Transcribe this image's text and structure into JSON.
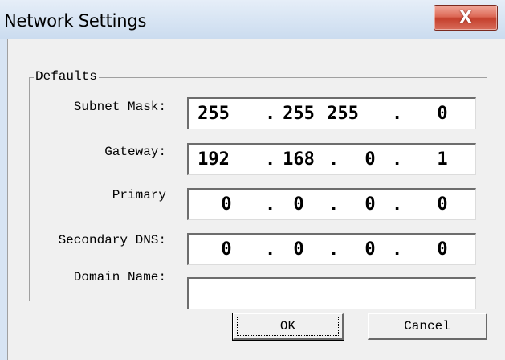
{
  "window": {
    "title": "Network Settings",
    "close_glyph": "X"
  },
  "group": {
    "legend": "Defaults"
  },
  "fields": {
    "subnet_mask": {
      "label": "Subnet Mask:",
      "octets": [
        "255",
        "255",
        "255",
        "0"
      ]
    },
    "gateway": {
      "label": "Gateway:",
      "octets": [
        "192",
        "168",
        "0",
        "1"
      ]
    },
    "primary": {
      "label": "Primary",
      "octets": [
        "0",
        "0",
        "0",
        "0"
      ]
    },
    "secondary_dns": {
      "label": "Secondary DNS:",
      "octets": [
        "0",
        "0",
        "0",
        "0"
      ]
    },
    "domain_name": {
      "label": "Domain Name:",
      "value": ""
    }
  },
  "separator": ".",
  "buttons": {
    "ok": "OK",
    "cancel": "Cancel"
  },
  "colors": {
    "dialog_bg": "#f0f0f0",
    "close_button": "#c5412e",
    "titlebar": "#d7e4f3"
  }
}
